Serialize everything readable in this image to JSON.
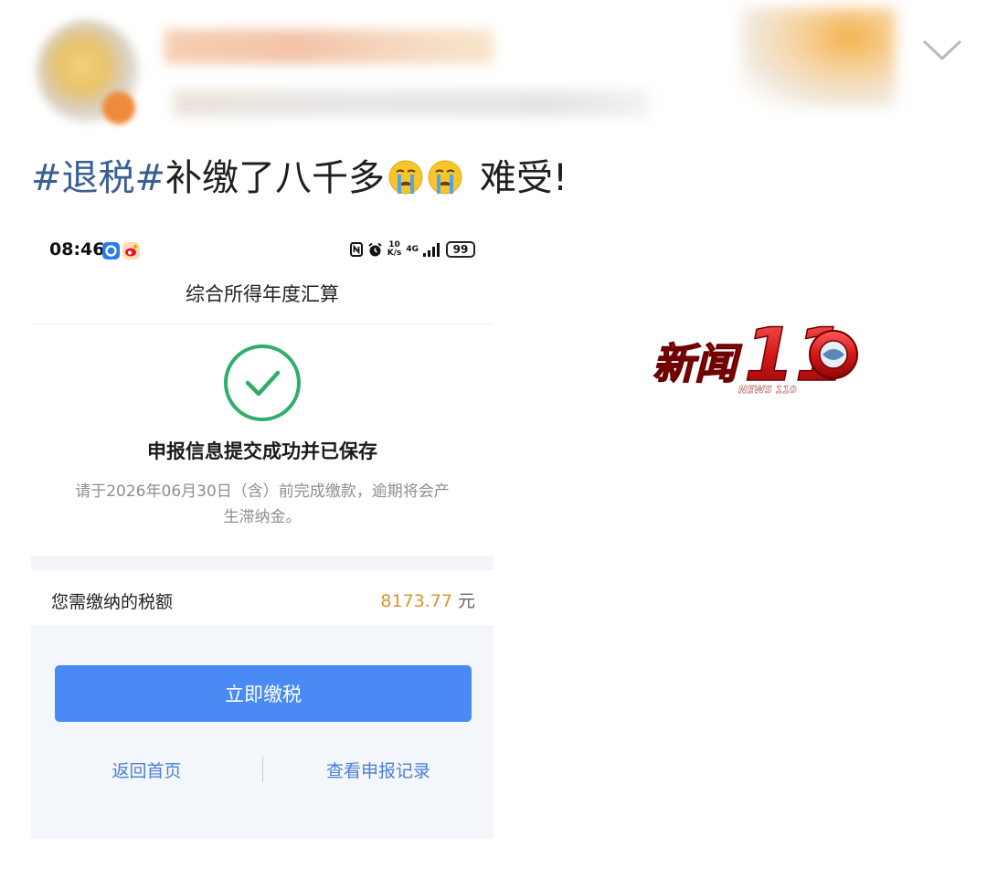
{
  "post": {
    "hashtag": "#退税#",
    "body": "补缴了八千多",
    "emojis": [
      "crying-face-icon",
      "crying-face-icon"
    ],
    "tail": "难受!"
  },
  "screenshot": {
    "status_bar": {
      "time": "08:46",
      "net_speed_top": "10",
      "net_speed_bottom": "K/s",
      "network": "4G",
      "battery": "99"
    },
    "nav_title": "综合所得年度汇算",
    "result": {
      "title": "申报信息提交成功并已保存",
      "note": "请于2026年06月30日（含）前完成缴款，逾期将会产生滞纳金。"
    },
    "tax": {
      "label": "您需缴纳的税额",
      "amount": "8173.77",
      "unit": "元"
    },
    "actions": {
      "pay_label": "立即缴税",
      "home_label": "返回首页",
      "records_label": "查看申报记录"
    }
  },
  "watermark": {
    "logo_text": "新闻110",
    "logo_sub": "NEWS 110"
  },
  "colors": {
    "hashtag": "#3a5f93",
    "success_green": "#2fae6b",
    "amount_orange": "#d8942e",
    "primary_blue": "#4a8af4",
    "link_blue": "#4a7fd6"
  }
}
